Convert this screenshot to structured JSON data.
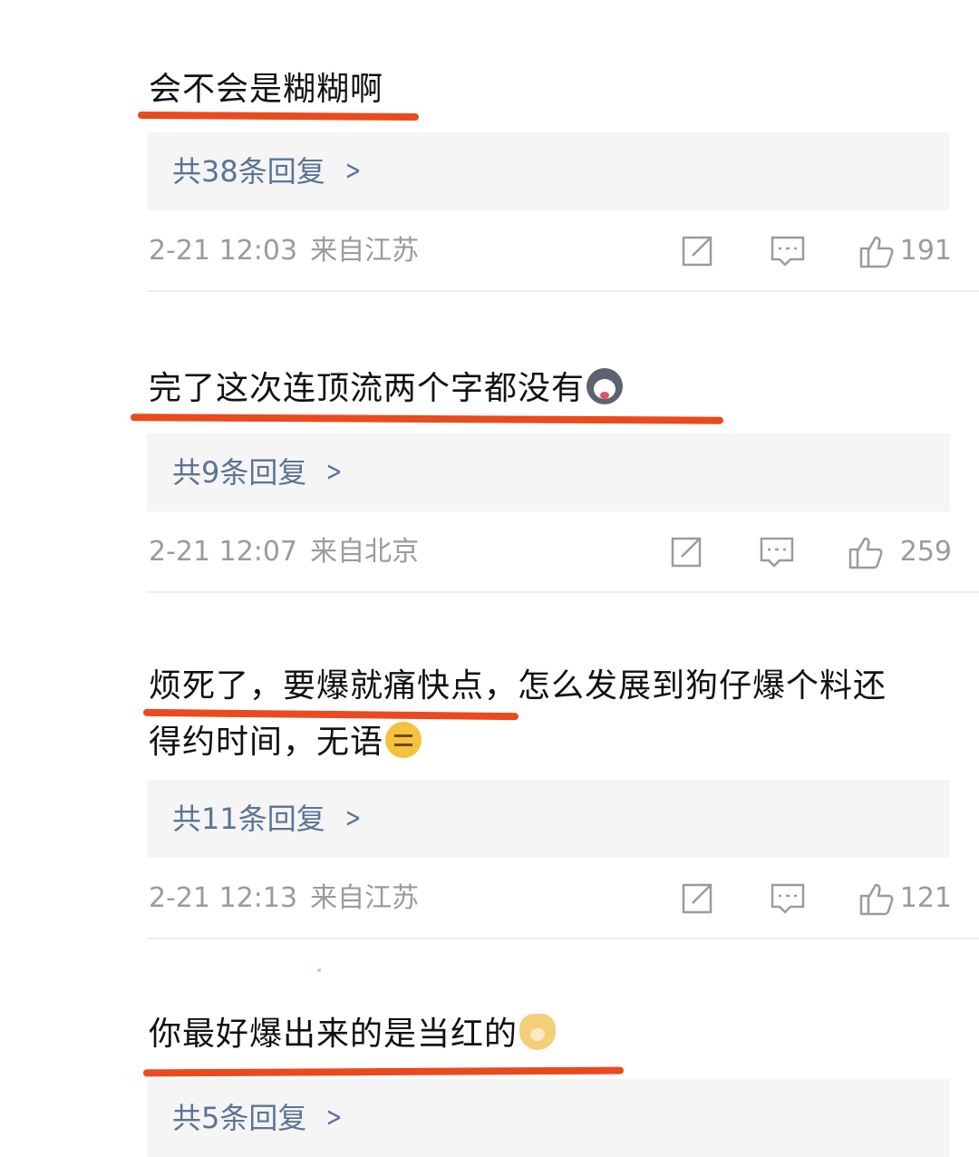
{
  "comments": [
    {
      "text": "会不会是糊糊啊",
      "emoji": "",
      "replies_label": "共38条回复",
      "time": "2-21 12:03",
      "location": "来自江苏",
      "likes": "191"
    },
    {
      "text": "完了这次连顶流两个字都没有",
      "emoji": "husky-emoji",
      "replies_label": "共9条回复",
      "time": "2-21 12:07",
      "location": "来自北京",
      "likes": "259"
    },
    {
      "text_line1": "烦死了，要爆就痛快点，怎么发展到狗仔爆个料还",
      "text_line2": "得约时间，无语",
      "emoji": "neutral-face-emoji",
      "replies_label": "共11条回复",
      "time": "2-21 12:13",
      "location": "来自江苏",
      "likes": "121"
    },
    {
      "text": "你最好爆出来的是当红的",
      "emoji": "dog-emoji",
      "replies_label": "共5条回复"
    }
  ],
  "icons": {
    "repost": "repost-icon",
    "comment": "comment-icon",
    "like": "thumbs-up-icon",
    "chevron": "chevron-right-icon"
  },
  "colors": {
    "underline": "#ea4a1e",
    "reply_link": "#5b7396",
    "meta_text": "#9b9b9b",
    "reply_bg": "#f5f5f5"
  }
}
